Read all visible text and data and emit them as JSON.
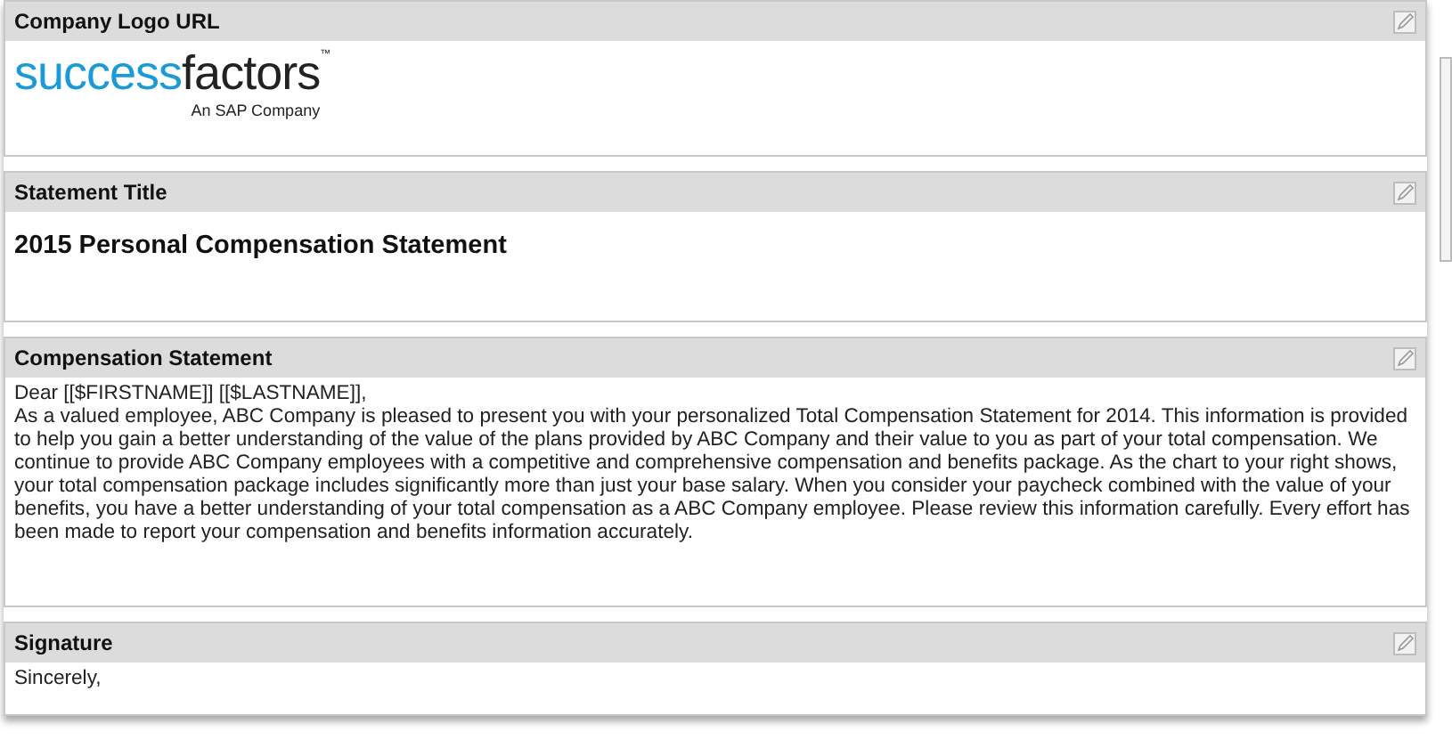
{
  "sections": [
    {
      "kind": "logo",
      "title": "Company Logo URL",
      "logo": {
        "word_1": "success",
        "word_2": "factors",
        "trademark": "™",
        "tagline": "An SAP Company"
      }
    },
    {
      "kind": "heading",
      "title": "Statement Title",
      "heading": "2015 Personal Compensation Statement"
    },
    {
      "kind": "text",
      "title": "Compensation Statement",
      "paragraphs": [
        "Dear [[$FIRSTNAME]] [[$LASTNAME]],",
        "As a valued employee, ABC Company is pleased to present you with your personalized Total Compensation Statement for 2014. This information is provided to help you gain a better understanding of the value of the plans provided by ABC Company and their value to you as part of your total compensation. We continue to provide ABC Company employees with a competitive and comprehensive compensation and benefits package. As the chart to your right shows, your total compensation package includes significantly more than just your base salary. When you consider your paycheck combined with the value of your benefits, you have a better understanding of your total compensation as a ABC Company employee. Please review this information carefully. Every effort has been made to report your compensation and benefits information accurately."
      ]
    },
    {
      "kind": "text",
      "title": "Signature",
      "paragraphs": [
        "Sincerely,"
      ]
    }
  ]
}
